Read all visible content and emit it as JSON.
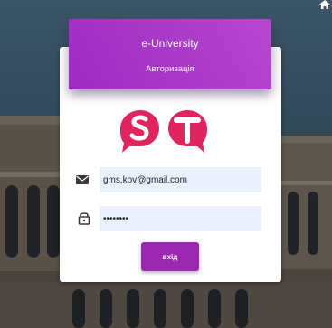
{
  "header": {
    "title": "e-University",
    "subtitle": "Авторизація"
  },
  "form": {
    "email_value": "gms.kov@gmail.com",
    "password_value": "••••••••",
    "submit_label": "вхід"
  },
  "icons": {
    "top_right": "home-icon",
    "email": "envelope-icon",
    "password": "lock-icon",
    "logo": "st-logo"
  },
  "colors": {
    "accent": "#9c27b0",
    "logo": "#e0245e",
    "field_bg": "#e8f0fe"
  }
}
